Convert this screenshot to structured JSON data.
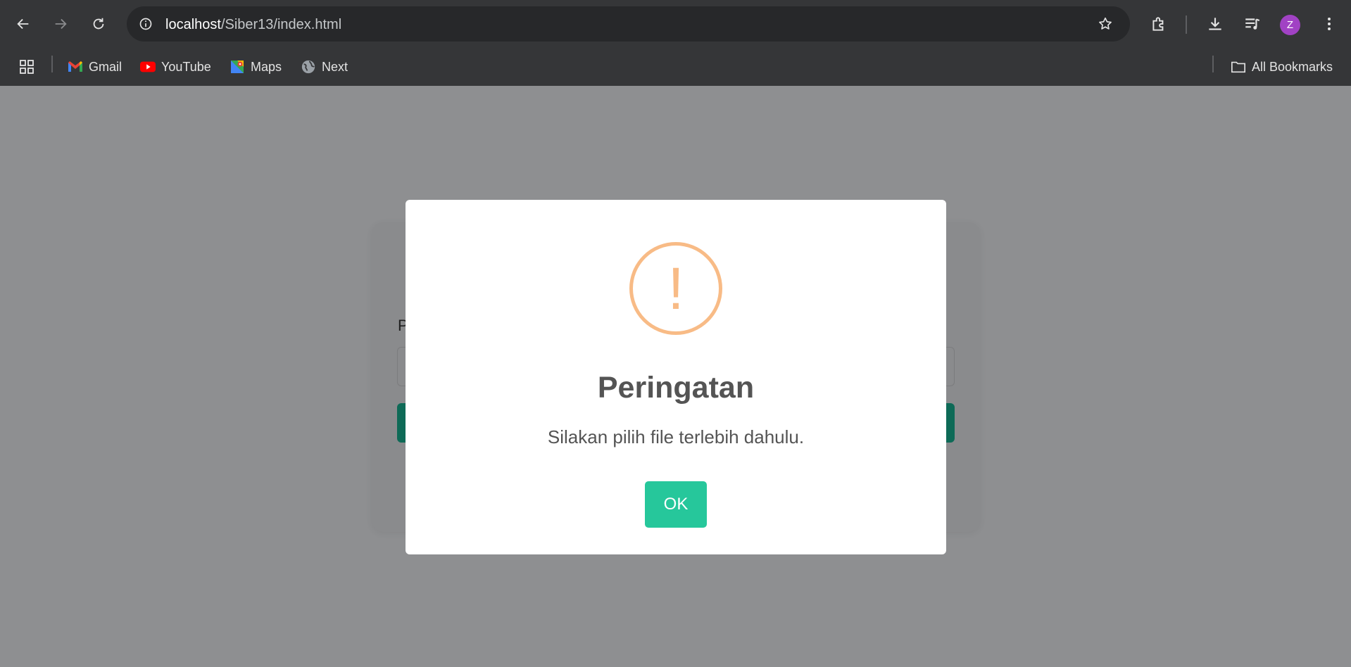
{
  "browser": {
    "url_host": "localhost",
    "url_path": "/Siber13/index.html",
    "profile_initial": "Z",
    "bookmarks": [
      {
        "label": "Gmail",
        "icon": "gmail-icon"
      },
      {
        "label": "YouTube",
        "icon": "youtube-icon"
      },
      {
        "label": "Maps",
        "icon": "maps-icon"
      },
      {
        "label": "Next",
        "icon": "globe-icon"
      }
    ],
    "all_bookmarks_label": "All Bookmarks"
  },
  "page": {
    "label_partial": "P"
  },
  "modal": {
    "icon_glyph": "!",
    "title": "Peringatan",
    "text": "Silakan pilih file terlebih dahulu.",
    "ok_label": "OK",
    "accent_color": "#f8bb86",
    "confirm_color": "#26c79b"
  }
}
